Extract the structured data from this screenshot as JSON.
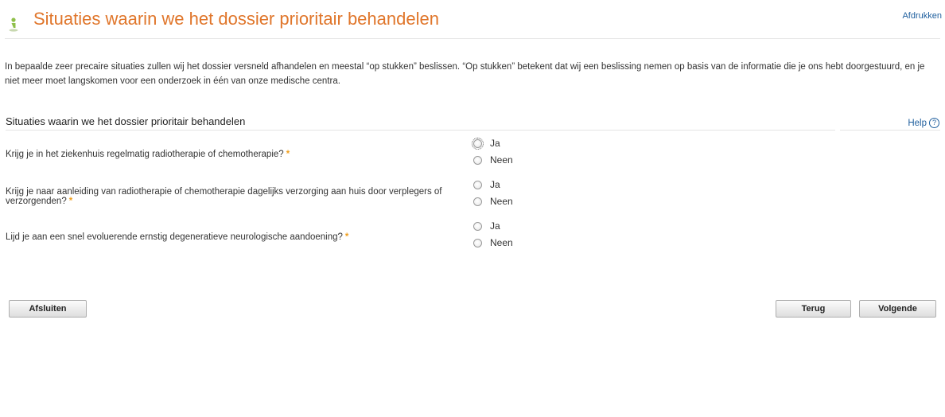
{
  "header": {
    "title": "Situaties waarin we het dossier prioritair behandelen",
    "print_label": "Afdrukken",
    "icon": "person-icon",
    "title_color": "#e0762b"
  },
  "intro": "In bepaalde zeer precaire situaties zullen wij het dossier versneld afhandelen en meestal “op stukken” beslissen. “Op stukken” betekent dat wij een beslissing nemen op basis van de informatie die je ons hebt doorgestuurd, en je niet meer moet langskomen voor een onderzoek in één van onze medische centra.",
  "section": {
    "title": "Situaties waarin we het dossier prioritair behandelen",
    "help_label": "Help",
    "help_icon": "question-circle-icon"
  },
  "questions": [
    {
      "text": "Krijg je in het ziekenhuis regelmatig radiotherapie of chemotherapie?",
      "required_mark": "*",
      "options": [
        "Ja",
        "Neen"
      ]
    },
    {
      "text": "Krijg je naar aanleiding van radiotherapie of chemotherapie dagelijks verzorging aan huis door verplegers of verzorgenden?",
      "required_mark": "*",
      "options": [
        "Ja",
        "Neen"
      ]
    },
    {
      "text": "Lijd je aan een snel evoluerende ernstig degeneratieve neurologische aandoening?",
      "required_mark": "*",
      "options": [
        "Ja",
        "Neen"
      ]
    }
  ],
  "buttons": {
    "close": "Afsluiten",
    "back": "Terug",
    "next": "Volgende"
  }
}
